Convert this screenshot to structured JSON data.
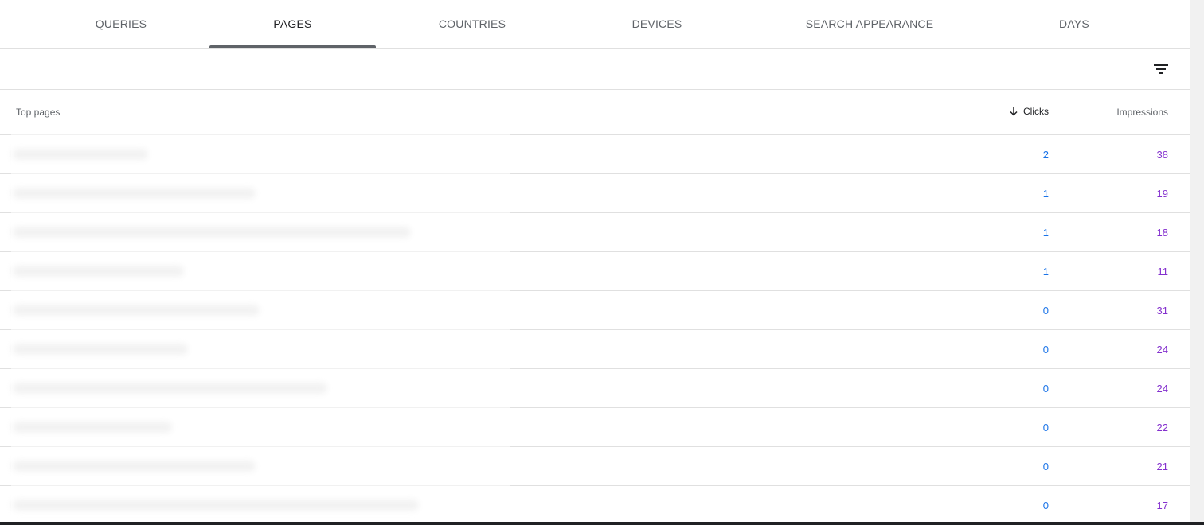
{
  "tabs": [
    {
      "label": "QUERIES"
    },
    {
      "label": "PAGES"
    },
    {
      "label": "COUNTRIES"
    },
    {
      "label": "DEVICES"
    },
    {
      "label": "SEARCH APPEARANCE"
    },
    {
      "label": "DAYS"
    }
  ],
  "active_tab": "PAGES",
  "toolbar": {
    "filter_icon": "filter-list-icon"
  },
  "table": {
    "title": "Top pages",
    "clicks_header": "Clicks",
    "impressions_header": "Impressions",
    "sort_icon": "arrow-down-icon",
    "rows": [
      {
        "clicks": "2",
        "impressions": "38"
      },
      {
        "clicks": "1",
        "impressions": "19"
      },
      {
        "clicks": "1",
        "impressions": "18"
      },
      {
        "clicks": "1",
        "impressions": "11"
      },
      {
        "clicks": "0",
        "impressions": "31"
      },
      {
        "clicks": "0",
        "impressions": "24"
      },
      {
        "clicks": "0",
        "impressions": "24"
      },
      {
        "clicks": "0",
        "impressions": "22"
      },
      {
        "clicks": "0",
        "impressions": "21"
      },
      {
        "clicks": "0",
        "impressions": "17"
      }
    ]
  },
  "colors": {
    "clicks": "#1a73e8",
    "impressions": "#8430ce",
    "active_tab_indicator": "#5f6368"
  }
}
